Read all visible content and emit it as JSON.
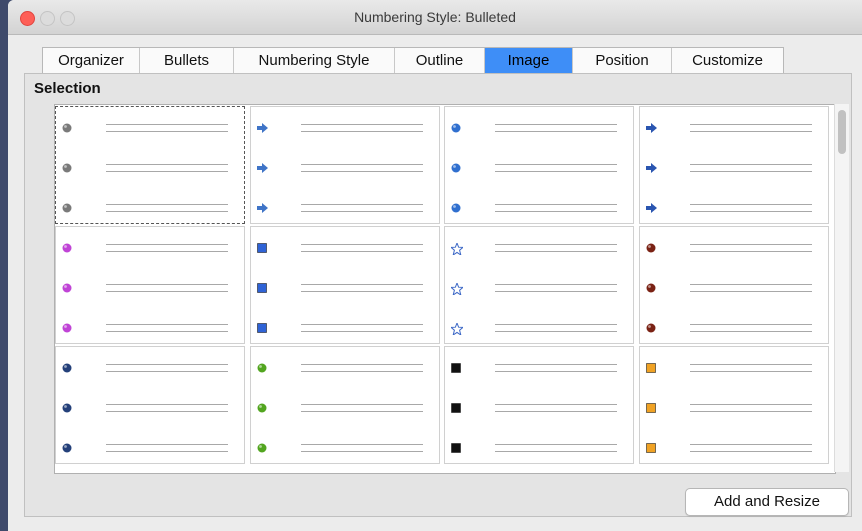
{
  "window": {
    "title": "Numbering Style: Bulleted"
  },
  "tabs": [
    {
      "label": "Organizer",
      "active": false
    },
    {
      "label": "Bullets",
      "active": false
    },
    {
      "label": "Numbering Style",
      "active": false
    },
    {
      "label": "Outline",
      "active": false
    },
    {
      "label": "Image",
      "active": true
    },
    {
      "label": "Position",
      "active": false
    },
    {
      "label": "Customize",
      "active": false
    }
  ],
  "selection": {
    "title": "Selection"
  },
  "bullet_styles": [
    {
      "name": "gray-sphere-icon",
      "color": "#7a7a7a"
    },
    {
      "name": "blue-arrow-icon",
      "color": "#3f74c7"
    },
    {
      "name": "blue-sphere-icon",
      "color": "#2f6fcf"
    },
    {
      "name": "blue-diamond-arrow-icon",
      "color": "#2a55b0"
    },
    {
      "name": "pink-sphere-icon",
      "color": "#c044d6"
    },
    {
      "name": "blue-square-icon",
      "color": "#2f63d6"
    },
    {
      "name": "blue-star-icon",
      "color": "#3b67c6"
    },
    {
      "name": "brown-sphere-icon",
      "color": "#7a2214"
    },
    {
      "name": "navy-sphere-icon",
      "color": "#24407a"
    },
    {
      "name": "green-sphere-icon",
      "color": "#52a51f"
    },
    {
      "name": "black-square-icon",
      "color": "#111111"
    },
    {
      "name": "orange-square-icon",
      "color": "#f0a224"
    }
  ],
  "selected_style_index": 0,
  "buttons": {
    "add_resize": "Add and Resize"
  }
}
